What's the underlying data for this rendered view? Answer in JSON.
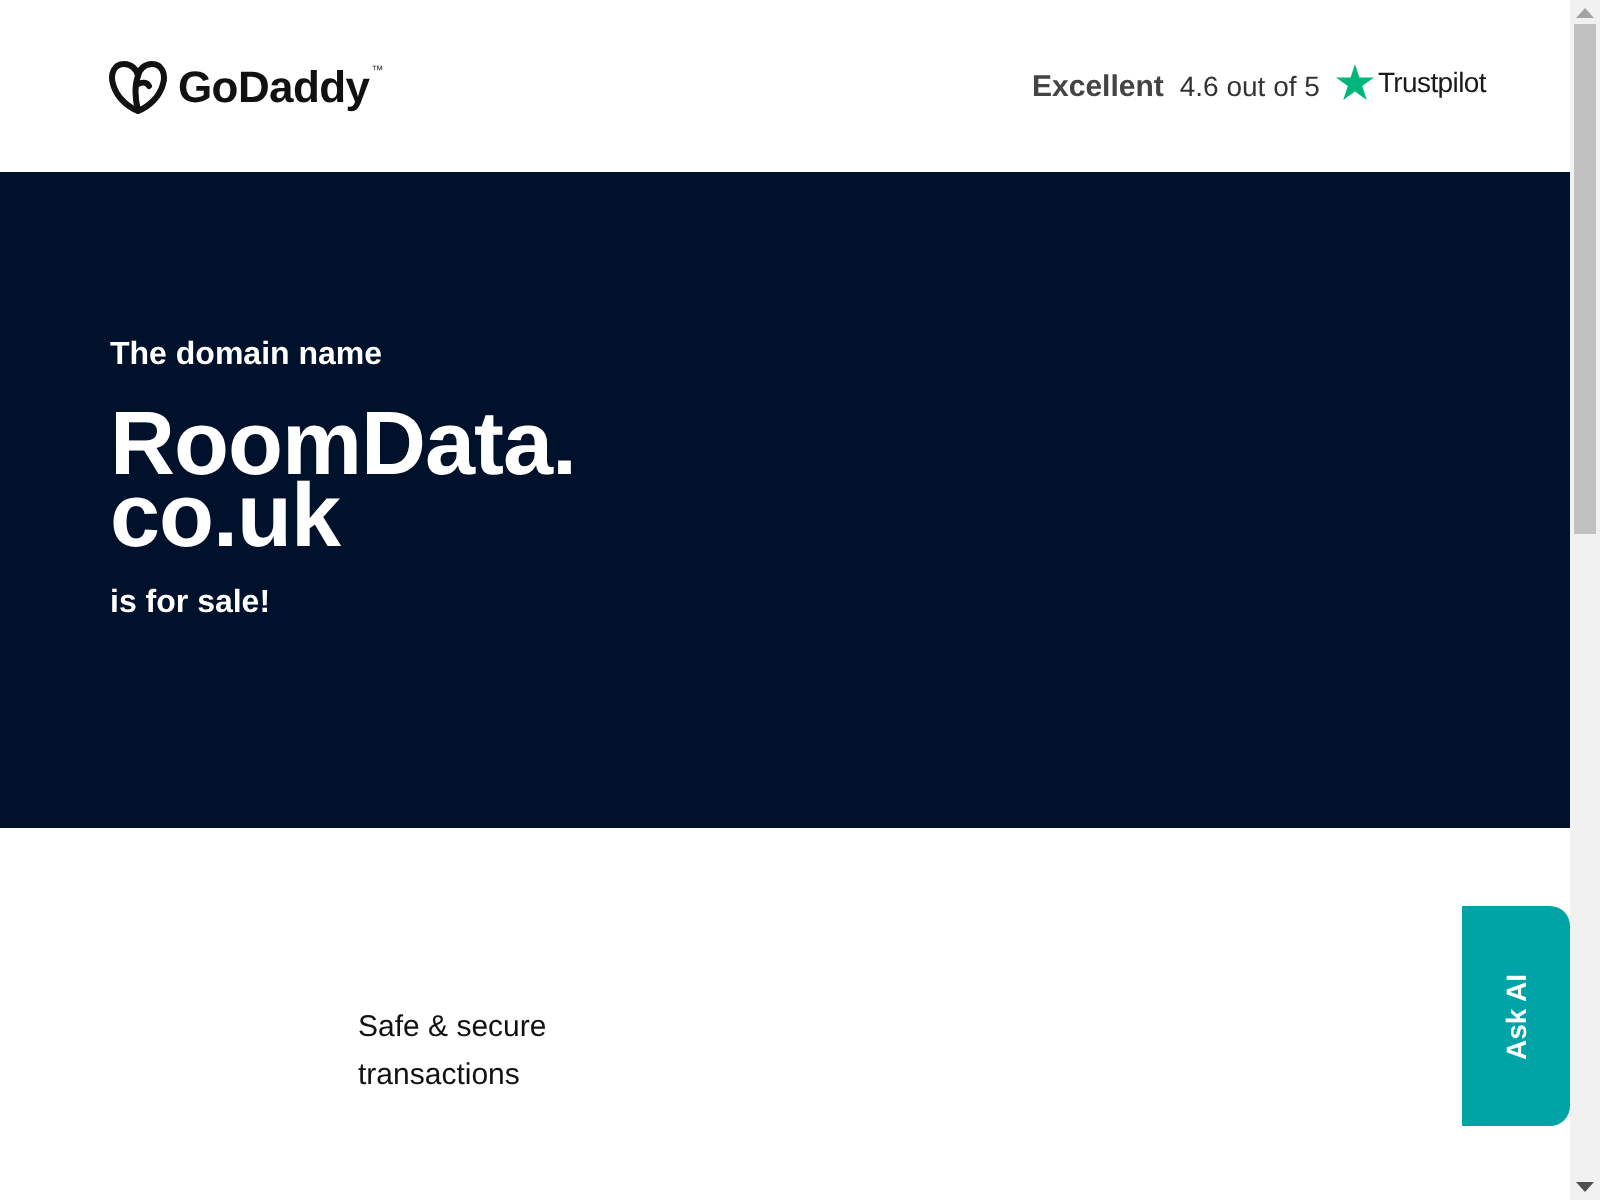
{
  "header": {
    "logo": {
      "wordmark": "GoDaddy",
      "trademark": "™"
    },
    "rating": {
      "label": "Excellent",
      "score": "4.6 out of 5",
      "provider": "Trustpilot"
    }
  },
  "hero": {
    "eyebrow": "The domain name",
    "domain_lines": [
      "RoomData.",
      "co.uk"
    ],
    "tagline": "is for sale!"
  },
  "features": [
    {
      "text": "Safe & secure transactions"
    }
  ],
  "ask_ai_button": {
    "label": "Ask AI"
  }
}
